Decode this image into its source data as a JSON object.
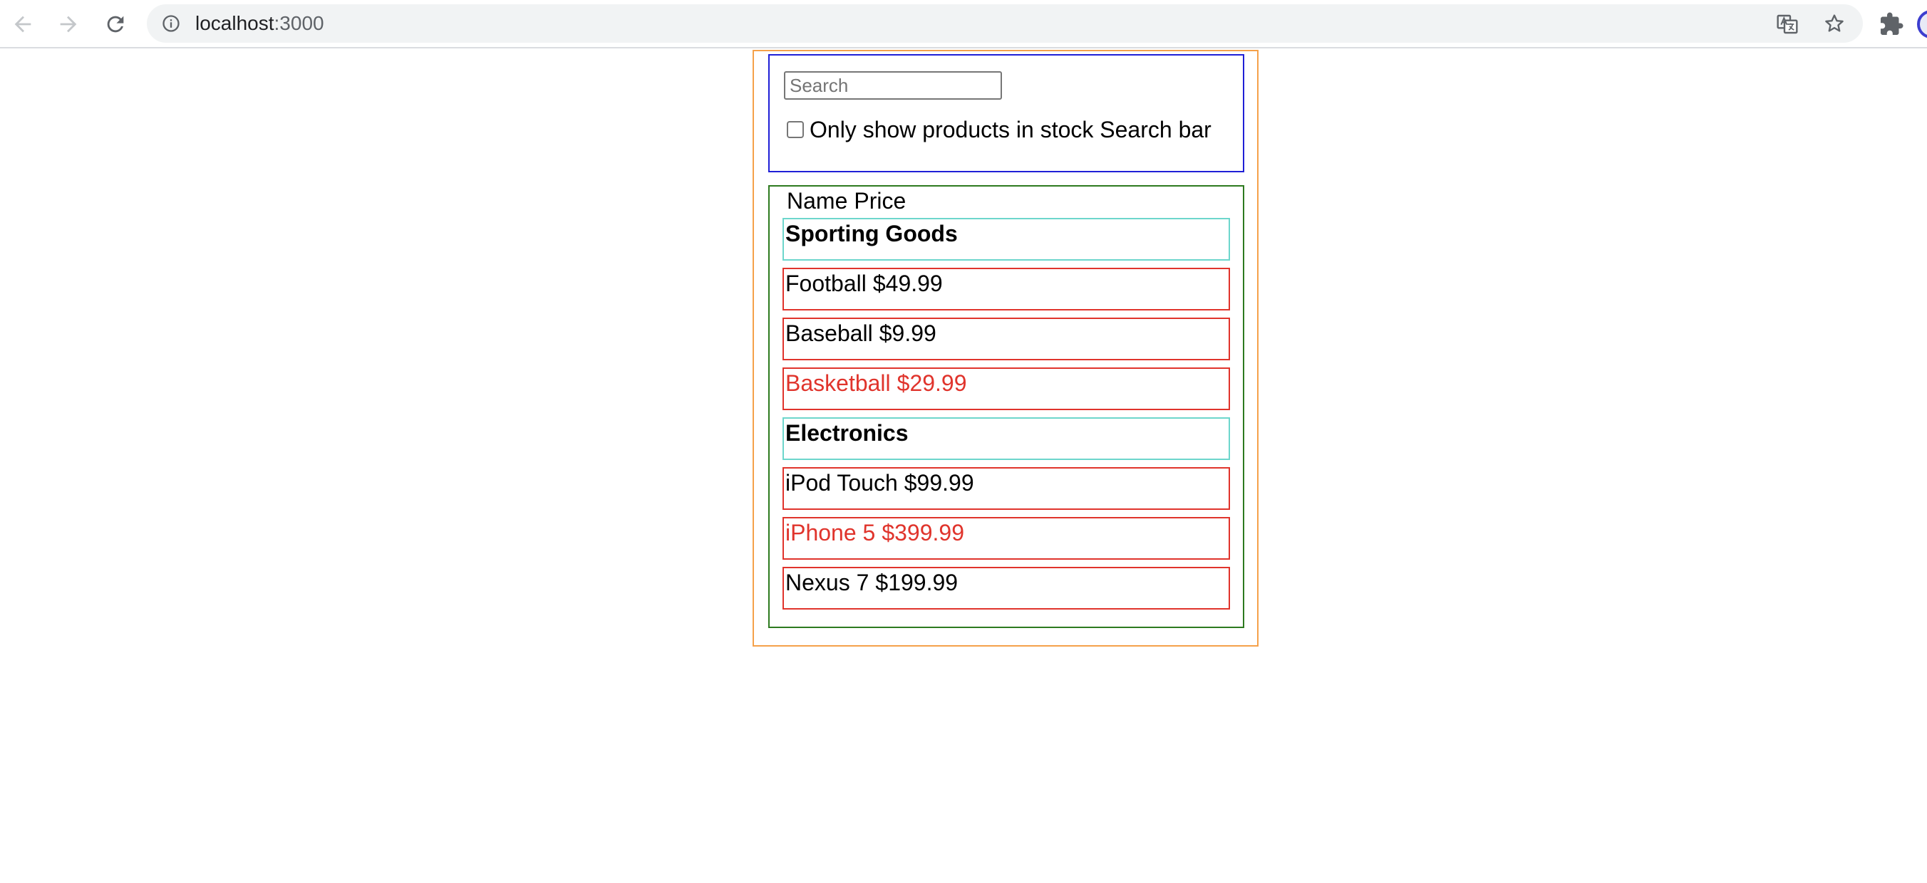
{
  "browser": {
    "url_host": "localhost",
    "url_port": ":3000",
    "icons": {
      "back": "arrow-left-icon",
      "forward": "arrow-right-icon",
      "reload": "reload-icon",
      "site_info": "info-icon",
      "translate": "translate-icon",
      "bookmark": "star-icon",
      "extensions": "puzzle-icon"
    }
  },
  "search_bar": {
    "placeholder": "Search",
    "value": "",
    "stock_label": "Only show products in stock",
    "suffix_label": "Search bar",
    "stock_checked": false
  },
  "table": {
    "header_name": "Name",
    "header_price": "Price",
    "rows": [
      {
        "type": "category",
        "label": "Sporting Goods"
      },
      {
        "type": "product",
        "name": "Football",
        "price": "$49.99",
        "in_stock": true
      },
      {
        "type": "product",
        "name": "Baseball",
        "price": "$9.99",
        "in_stock": true
      },
      {
        "type": "product",
        "name": "Basketball",
        "price": "$29.99",
        "in_stock": false
      },
      {
        "type": "category",
        "label": "Electronics"
      },
      {
        "type": "product",
        "name": "iPod Touch",
        "price": "$99.99",
        "in_stock": true
      },
      {
        "type": "product",
        "name": "iPhone 5",
        "price": "$399.99",
        "in_stock": false
      },
      {
        "type": "product",
        "name": "Nexus 7",
        "price": "$199.99",
        "in_stock": true
      }
    ]
  },
  "colors": {
    "app_border": "#f5a14a",
    "search_bar_border": "#1f1fd6",
    "table_border": "#2d7a1f",
    "category_border": "#6dd6cc",
    "product_border": "#e0342c",
    "out_of_stock_text": "#e0342c"
  }
}
